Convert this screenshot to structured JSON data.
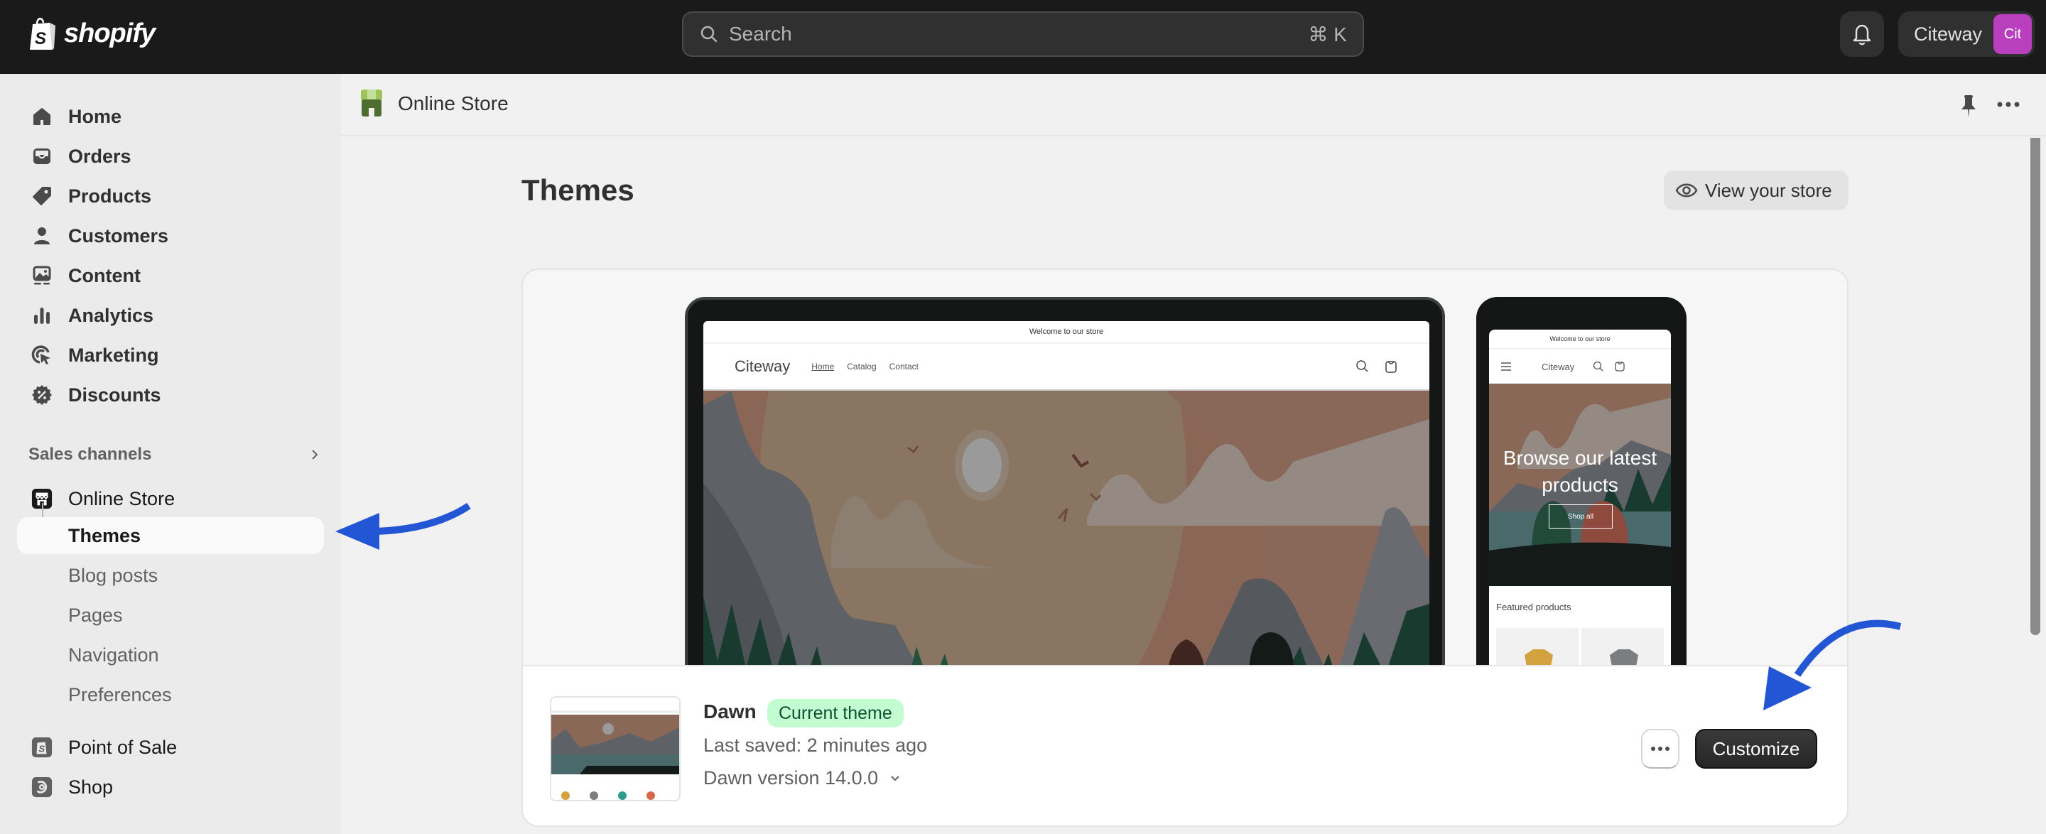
{
  "topbar": {
    "brand": "shopify",
    "search_placeholder": "Search",
    "search_shortcut": "⌘ K",
    "account_name": "Citeway",
    "avatar_initials": "Cit",
    "avatar_color": "#b93fbe"
  },
  "sidebar": {
    "items": [
      {
        "label": "Home",
        "icon": "home-icon"
      },
      {
        "label": "Orders",
        "icon": "inbox-icon"
      },
      {
        "label": "Products",
        "icon": "tag-icon"
      },
      {
        "label": "Customers",
        "icon": "person-icon"
      },
      {
        "label": "Content",
        "icon": "image-icon"
      },
      {
        "label": "Analytics",
        "icon": "bar-chart-icon"
      },
      {
        "label": "Marketing",
        "icon": "target-icon"
      },
      {
        "label": "Discounts",
        "icon": "discount-icon"
      }
    ],
    "sales_channels_label": "Sales channels",
    "online_store": {
      "label": "Online Store",
      "sub_items": [
        {
          "label": "Themes",
          "active": true
        },
        {
          "label": "Blog posts"
        },
        {
          "label": "Pages"
        },
        {
          "label": "Navigation"
        },
        {
          "label": "Preferences"
        }
      ]
    },
    "other_channels": [
      {
        "label": "Point of Sale"
      },
      {
        "label": "Shop"
      }
    ]
  },
  "main": {
    "breadcrumb": "Online Store",
    "page_title": "Themes",
    "view_store_label": "View your store",
    "preview": {
      "announcement": "Welcome to our store",
      "store_name": "Citeway",
      "nav": [
        "Home",
        "Catalog",
        "Contact"
      ],
      "hero_text": "Browse our latest products",
      "shop_all": "Shop all",
      "featured": "Featured products"
    },
    "theme": {
      "name": "Dawn",
      "badge": "Current theme",
      "badge_color": "#c4fcd1",
      "last_saved": "Last saved: 2 minutes ago",
      "version": "Dawn version 14.0.0",
      "customize_label": "Customize"
    }
  },
  "annotation_color": "#2356d4"
}
